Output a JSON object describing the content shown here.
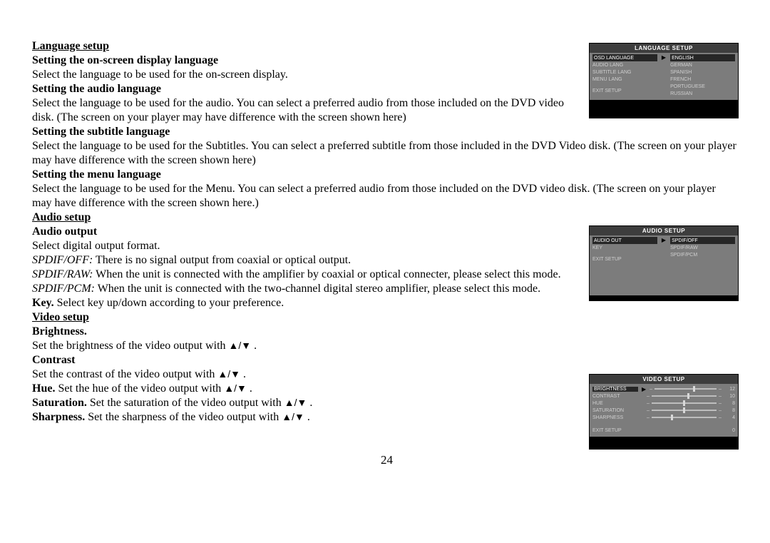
{
  "arrows": "▲/▼",
  "sections": {
    "lang": {
      "heading": "Language setup",
      "osd_heading": "Setting the on-screen display language",
      "osd_body": "Select the language to be used for the on-screen display.",
      "audio_heading": "Setting the audio language",
      "audio_body": "Select the language to be used for the audio. You can select a preferred audio from those included on the DVD video disk. (The screen on your player may have difference with the screen shown here)",
      "sub_heading": "Setting the subtitle language",
      "sub_body": "Select the language to be used for the Subtitles. You can select a preferred subtitle from those included in the DVD Video disk. (The screen on your player may have difference with the screen shown here)",
      "menu_heading": "Setting the menu language",
      "menu_body": "Select the language to be used for the Menu. You can select a preferred audio from those included on the DVD video disk. (The screen on your player may have difference with the screen shown here.)"
    },
    "audio": {
      "heading": "Audio setup",
      "out_heading": "Audio output",
      "out_body": "Select digital output format.",
      "spdif_off_label": "SPDIF/OFF:",
      "spdif_off_body": " There is no signal output from coaxial or optical output.",
      "spdif_raw_label": "SPDIF/RAW:",
      "spdif_raw_body": " When the unit is connected with the amplifier by coaxial or optical connecter, please select this mode.",
      "spdif_pcm_label": "SPDIF/PCM:",
      "spdif_pcm_body": " When the unit is connected with the two-channel digital stereo amplifier, please select this mode.",
      "key_label": "Key.",
      "key_body": " Select key up/down according to your preference."
    },
    "video": {
      "heading": "Video setup",
      "bright_heading": "Brightness.",
      "bright_body_pre": "Set the brightness of the video output with ",
      "bright_body_post": " .",
      "contrast_heading": "Contrast",
      "contrast_body_pre": "Set the contrast of the video output with ",
      "contrast_body_post": " .",
      "hue_label": "Hue.",
      "hue_body_pre": " Set the hue of the video output with ",
      "hue_body_post": " .",
      "sat_label": "Saturation.",
      "sat_body_pre": " Set the saturation of the video output with ",
      "sat_body_post": " .",
      "sharp_label": "Sharpness.",
      "sharp_body_pre": " Set the sharpness of the video output with ",
      "sharp_body_post": " ."
    }
  },
  "page_number": "24",
  "osd_lang": {
    "title": "LANGUAGE SETUP",
    "left": [
      "OSD LANGUAGE",
      "AUDIO LANG",
      "SUBTITLE LANG",
      "MENU LANG"
    ],
    "exit": "EXIT  SETUP",
    "right": [
      "ENGLISH",
      "GERMAN",
      "SPANISH",
      "FRENCH",
      "PORTUGUESE",
      "RUSSIAN"
    ]
  },
  "osd_audio": {
    "title": "AUDIO SETUP",
    "left": [
      "AUDIO OUT",
      "KEY"
    ],
    "exit": "EXIT  SETUP",
    "right": [
      "SPDIF/OFF",
      "SPDIF/RAW",
      "SPDIF/PCM"
    ]
  },
  "osd_video": {
    "title": "VIDEO SETUP",
    "rows": [
      {
        "label": "BRIGHTNESS",
        "val": "12",
        "pos": 62,
        "hl": true
      },
      {
        "label": "CONTRAST",
        "val": "10",
        "pos": 55
      },
      {
        "label": "HUE",
        "val": "8",
        "pos": 48
      },
      {
        "label": "SATURATION",
        "val": "8",
        "pos": 48
      },
      {
        "label": "SHARPNESS",
        "val": "4",
        "pos": 30
      }
    ],
    "exit": "EXIT  SETUP",
    "exit_val": "0"
  }
}
